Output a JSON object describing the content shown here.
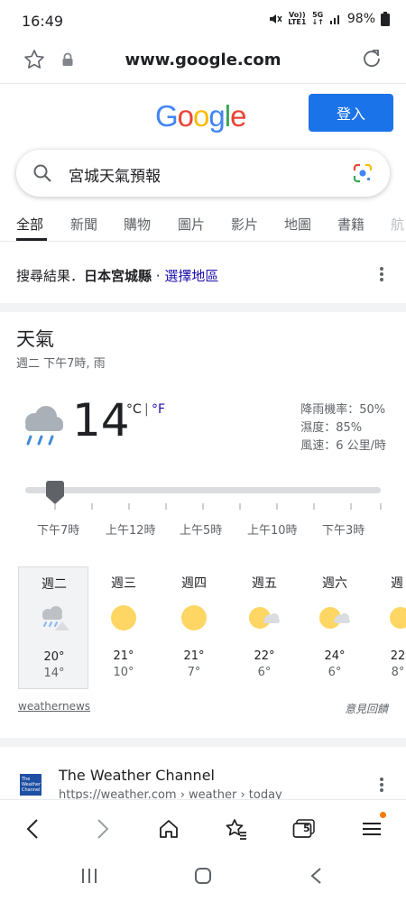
{
  "status": {
    "time": "16:49",
    "battery": "98%",
    "net_top": "Vo))",
    "net_bottom": "LTE1",
    "net5g_top": "5G",
    "net5g_bottom": "↓↑"
  },
  "browser": {
    "url": "www.google.com"
  },
  "google": {
    "logo": [
      "G",
      "o",
      "o",
      "g",
      "l",
      "e"
    ],
    "logo_colors": [
      "#4285F4",
      "#EA4335",
      "#FBBC05",
      "#4285F4",
      "#34A853",
      "#EA4335"
    ],
    "signin_label": "登入"
  },
  "search": {
    "query": "宮城天氣預報"
  },
  "tabs": [
    "全部",
    "新聞",
    "購物",
    "圖片",
    "影片",
    "地圖",
    "書籍",
    "航"
  ],
  "results": {
    "prefix": "搜尋結果．",
    "location": "日本宮城縣",
    "dot": " · ",
    "change_region": "選擇地區"
  },
  "weather": {
    "title": "天氣",
    "subtitle": "週二 下午7時, 雨",
    "temp": "14",
    "unit_c": "°C",
    "unit_sep": "|",
    "unit_f": "°F",
    "precip": "降雨機率：50%",
    "humidity": "濕度：85%",
    "wind": "風速：6 公里/時",
    "times": [
      "下午7時",
      "上午12時",
      "上午5時",
      "上午10時",
      "下午3時"
    ],
    "days": [
      {
        "name": "週二",
        "hi": "20°",
        "lo": "14°",
        "icon": "rain-icon"
      },
      {
        "name": "週三",
        "hi": "21°",
        "lo": "10°",
        "icon": "sun-icon"
      },
      {
        "name": "週四",
        "hi": "21°",
        "lo": "7°",
        "icon": "sun-icon"
      },
      {
        "name": "週五",
        "hi": "22°",
        "lo": "6°",
        "icon": "partly-cloudy-icon"
      },
      {
        "name": "週六",
        "hi": "24°",
        "lo": "6°",
        "icon": "partly-cloudy-icon"
      },
      {
        "name": "週",
        "hi": "22",
        "lo": "8°",
        "icon": "partly-cloudy-icon"
      }
    ],
    "source": "weathernews",
    "feedback": "意見回饋"
  },
  "result2": {
    "logo_text": "The Weather Channel",
    "title": "The Weather Channel",
    "url": "https://weather.com › weather › today"
  },
  "bottom_nav": {
    "tabs_count": "5"
  },
  "colors": {
    "accent": "#1a73e8",
    "link": "#1a0dab",
    "sun": "#fdd663"
  }
}
